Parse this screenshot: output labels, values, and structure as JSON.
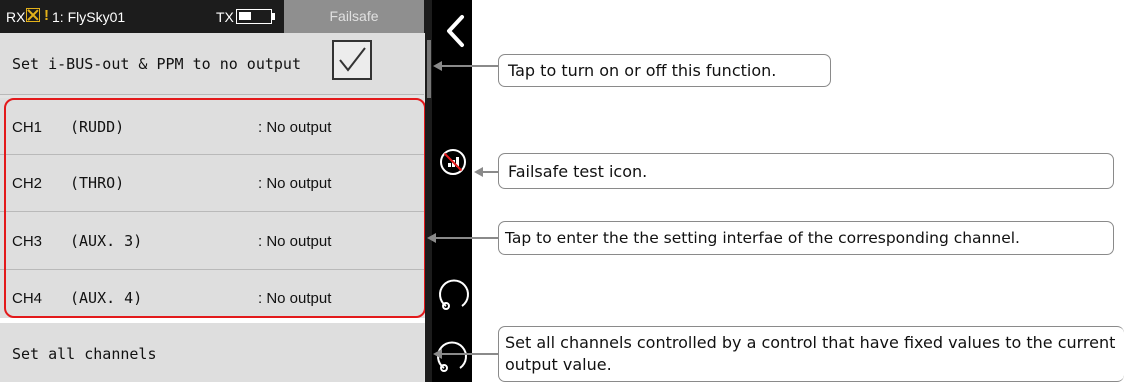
{
  "header": {
    "rx_label": "RX",
    "warning": "!",
    "model_name": "1: FlySky01",
    "tx_label": "TX",
    "battery_level_pct": 40,
    "title": "Failsafe"
  },
  "toggle_row": {
    "label": "Set i-BUS-out & PPM to no output",
    "checked": true
  },
  "channels": [
    {
      "number": "CH1",
      "name": "(RUDD)",
      "value": ": No output"
    },
    {
      "number": "CH2",
      "name": "(THRO)",
      "value": ": No output"
    },
    {
      "number": "CH3",
      "name": "(AUX. 3)",
      "value": ": No output"
    },
    {
      "number": "CH4",
      "name": "(AUX. 4)",
      "value": ": No output"
    }
  ],
  "set_all_row": {
    "label": "Set all channels"
  },
  "icons": {
    "back": "chevron-left-icon",
    "failsafe_test": "failsafe-test-icon",
    "rotate": "rotate-icon"
  },
  "callouts": {
    "toggle": "Tap to turn on or off  this function.",
    "test_icon": "Failsafe test icon.",
    "channel": "Tap to enter the the setting interfae of the corresponding channel.",
    "set_all": "Set all channels controlled by a control that have fixed values to the current output value."
  },
  "colors": {
    "highlight": "#e3191b",
    "warning": "#e3b21a",
    "title_tab": "#8f8f8f",
    "background": "#e3e3e3"
  }
}
